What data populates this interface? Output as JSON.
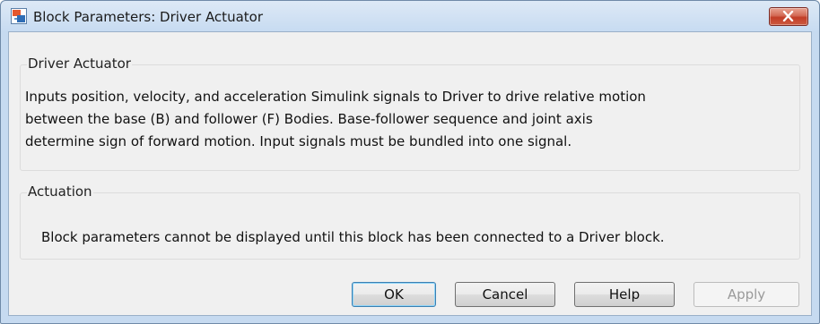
{
  "window": {
    "title": "Block Parameters: Driver Actuator"
  },
  "driver_actuator": {
    "legend": "Driver Actuator",
    "description_lines": [
      "Inputs position, velocity, and acceleration Simulink signals to Driver to drive relative motion",
      "between the base (B) and follower (F) Bodies. Base-follower sequence and joint axis",
      "determine sign of forward motion. Input signals must be bundled into one signal."
    ]
  },
  "actuation": {
    "legend": "Actuation",
    "message": "Block parameters cannot be displayed until this block has been connected to a Driver block."
  },
  "buttons": {
    "ok": "OK",
    "cancel": "Cancel",
    "help": "Help",
    "apply": "Apply"
  },
  "icons": {
    "app": "simulink-block-icon",
    "close": "close-icon"
  },
  "colors": {
    "title_bar": "#c7dbf1",
    "close_button": "#c94a33",
    "dialog_background": "#f0f0f0",
    "default_button_border": "#3c7fb1"
  }
}
